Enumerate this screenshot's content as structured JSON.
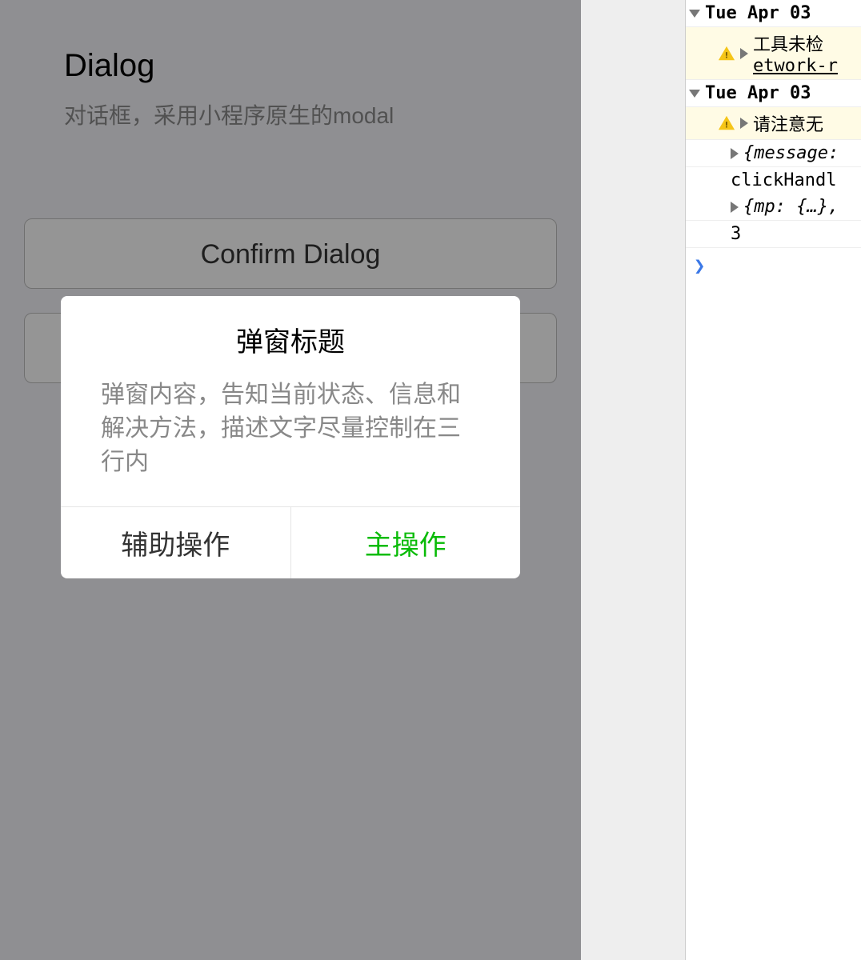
{
  "page": {
    "title": "Dialog",
    "subtitle": "对话框，采用小程序原生的modal",
    "buttons": {
      "confirm": "Confirm Dialog",
      "second": ""
    }
  },
  "modal": {
    "title": "弹窗标题",
    "content": "弹窗内容，告知当前状态、信息和解决方法，描述文字尽量控制在三行内",
    "secondary": "辅助操作",
    "primary": "主操作"
  },
  "console": {
    "group1": "Tue Apr 03",
    "warn1a": "工具未检",
    "warn1b": "etwork-r",
    "group2": "Tue Apr 03",
    "warn2": "请注意无",
    "msg": "{message:",
    "click": "clickHandl",
    "mp": "{mp: {…},",
    "three": "3",
    "prompt": "❯"
  }
}
